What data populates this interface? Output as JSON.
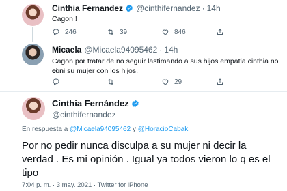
{
  "tweet1": {
    "name": "Cinthia Fernandez",
    "handle": "@cinthifernandez",
    "time": "14h",
    "text": "Cagon !",
    "replies": "246",
    "retweets": "39",
    "likes": "846"
  },
  "tweet2": {
    "name": "Micaela",
    "handle": "@Micaela94095462",
    "time": "14h",
    "text_line1": "Cagon por tratar de no seguir lastimando a sus hijos empatia cinthia no con",
    "text_line2": "el ni su mujer con los hijos.",
    "replies": "",
    "retweets": "",
    "likes": "29"
  },
  "tweet3": {
    "name": "Cinthia Fernández",
    "handle": "@cinthifernandez",
    "reply_prefix": "En respuesta a",
    "reply_to_1": "@Micaela94095462",
    "reply_and": "y",
    "reply_to_2": "@HoracioCabak",
    "text_line1": "Por no pedir nunca disculpa a su mujer ni decir la",
    "text_line2": "verdad . Es mi opinión . Igual ya todos vieron lo q es el",
    "text_line3": "tipo",
    "meta_time": "7:04 p. m.",
    "meta_date": "3 may. 2021",
    "meta_source": "Twitter for iPhone"
  },
  "colors": {
    "accent": "#1d9bf0",
    "secondary_text": "#536471",
    "divider": "#e6ecf0"
  }
}
